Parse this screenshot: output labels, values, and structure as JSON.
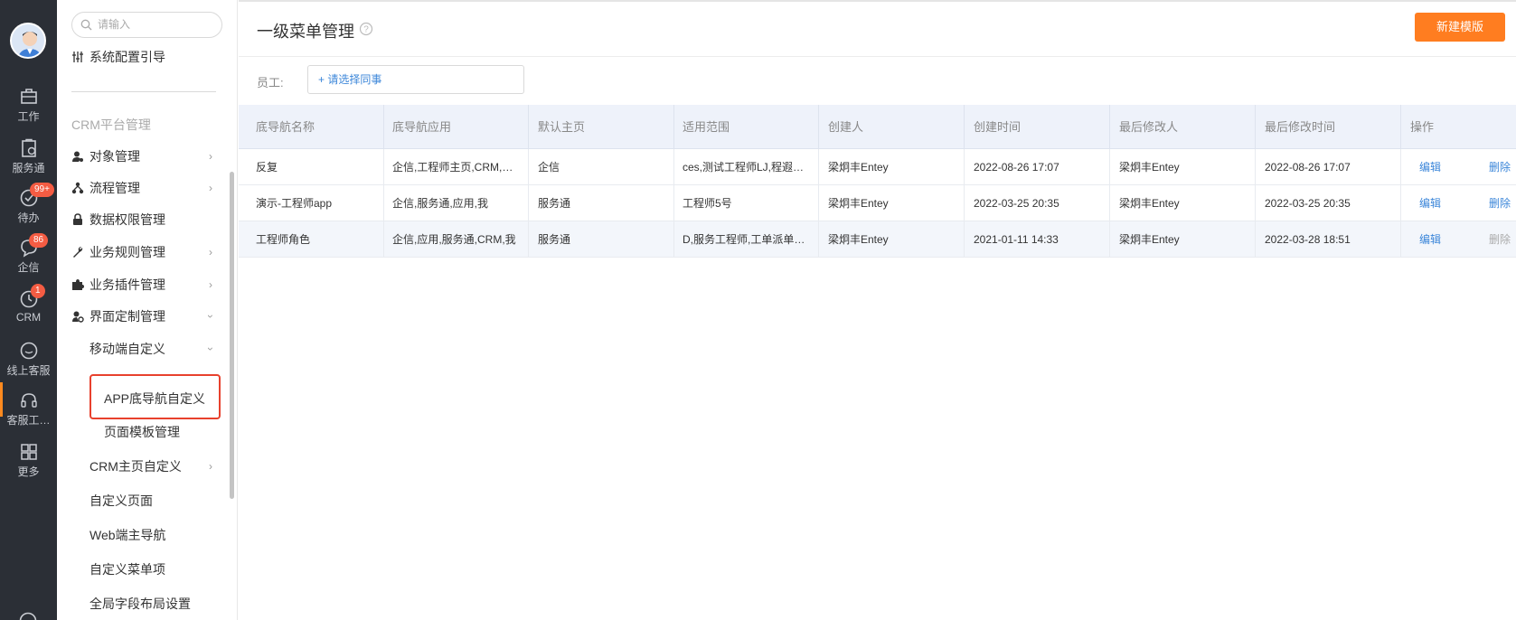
{
  "rail": {
    "items": [
      {
        "label": "工作",
        "icon": "briefcase-icon"
      },
      {
        "label": "服务通",
        "icon": "clipboard-icon"
      },
      {
        "label": "待办",
        "icon": "check-circle-icon",
        "badge": "99+"
      },
      {
        "label": "企信",
        "icon": "chat-icon",
        "badge": "86"
      },
      {
        "label": "CRM",
        "icon": "clock-icon",
        "badge": "1"
      },
      {
        "label": "线上客服",
        "icon": "chat-bubble-icon"
      },
      {
        "label": "客服工…",
        "icon": "headset-icon"
      },
      {
        "label": "更多",
        "icon": "grid-icon"
      }
    ]
  },
  "sidebar": {
    "search_placeholder": "请输入",
    "config_guide": "系统配置引导",
    "section_title": "CRM平台管理",
    "items": [
      {
        "label": "对象管理"
      },
      {
        "label": "流程管理"
      },
      {
        "label": "数据权限管理"
      },
      {
        "label": "业务规则管理"
      },
      {
        "label": "业务插件管理"
      },
      {
        "label": "界面定制管理"
      },
      {
        "label": "移动端自定义"
      },
      {
        "label": "APP底导航自定义"
      },
      {
        "label": "页面模板管理"
      },
      {
        "label": "CRM主页自定义"
      },
      {
        "label": "自定义页面"
      },
      {
        "label": "Web端主导航"
      },
      {
        "label": "自定义菜单项"
      },
      {
        "label": "全局字段布局设置"
      }
    ]
  },
  "main": {
    "title": "一级菜单管理",
    "new_button": "新建模版",
    "filter_label": "员工:",
    "filter_placeholder": "+ 请选择同事"
  },
  "table": {
    "columns": [
      "底导航名称",
      "底导航应用",
      "默认主页",
      "适用范围",
      "创建人",
      "创建时间",
      "最后修改人",
      "最后修改时间",
      "操作"
    ],
    "rows": [
      {
        "name": "反复",
        "apps": "企信,工程师主页,CRM,…",
        "home": "企信",
        "scope": "ces,测试工程师LJ,程遐…",
        "creator": "梁炯丰Entey",
        "created": "2022-08-26 17:07",
        "modifier": "梁炯丰Entey",
        "modified": "2022-08-26 17:07",
        "edit": "编辑",
        "delete": "删除"
      },
      {
        "name": "演示-工程师app",
        "apps": "企信,服务通,应用,我",
        "home": "服务通",
        "scope": "工程师5号",
        "creator": "梁炯丰Entey",
        "created": "2022-03-25 20:35",
        "modifier": "梁炯丰Entey",
        "modified": "2022-03-25 20:35",
        "edit": "编辑",
        "delete": "删除"
      },
      {
        "name": "工程师角色",
        "apps": "企信,应用,服务通,CRM,我",
        "home": "服务通",
        "scope": "D,服务工程师,工单派单…",
        "creator": "梁炯丰Entey",
        "created": "2021-01-11 14:33",
        "modifier": "梁炯丰Entey",
        "modified": "2022-03-28 18:51",
        "edit": "编辑",
        "delete": "删除"
      }
    ]
  },
  "colors": {
    "accent": "#ff7d20",
    "link": "#3b86d9",
    "rail_bg": "#2b2f36",
    "badge": "#f45c43",
    "highlight": "#e8412d"
  }
}
